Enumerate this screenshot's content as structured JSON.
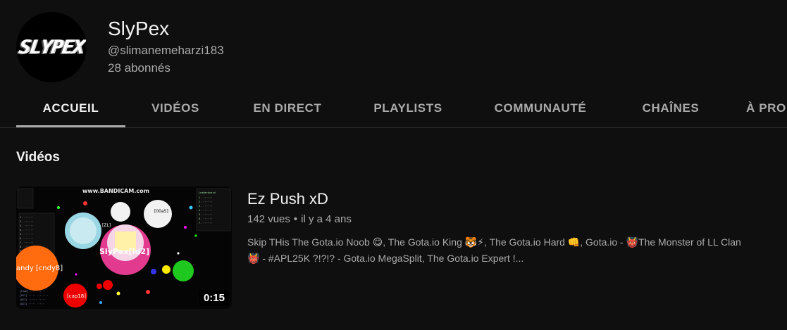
{
  "channel": {
    "avatar_text": "SLYPEX",
    "name": "SlyPex",
    "handle": "@slimanemeharzi183",
    "subscribers": "28 abonnés"
  },
  "tabs": [
    {
      "label": "ACCUEIL",
      "active": true
    },
    {
      "label": "VIDÉOS"
    },
    {
      "label": "EN DIRECT"
    },
    {
      "label": "PLAYLISTS"
    },
    {
      "label": "COMMUNAUTÉ"
    },
    {
      "label": "CHAÎNES"
    },
    {
      "label": "À PRO"
    }
  ],
  "section": {
    "title": "Vidéos"
  },
  "video": {
    "title": "Ez Push xD",
    "views": "142 vues",
    "age": "il y a 4 ans",
    "duration": "0:15",
    "description_line1": "Skip THis The Gota.io Noob 😋, The Gota.io King 🐯⚡, The Gota.io Hard 👊, Gota.io - 👹The Monster of LL Clan",
    "description_line2": "👹 - #APL25K ?!?!? - Gota.io MegaSplit, The Gota.io Expert !...",
    "thumbnail": {
      "watermark": "www.BANDICAM.com",
      "cell_labels": [
        "SlyPex[Id2]",
        "andy [cndy8]",
        "[cap18]",
        "[00a5]",
        "[ZL]"
      ]
    }
  }
}
